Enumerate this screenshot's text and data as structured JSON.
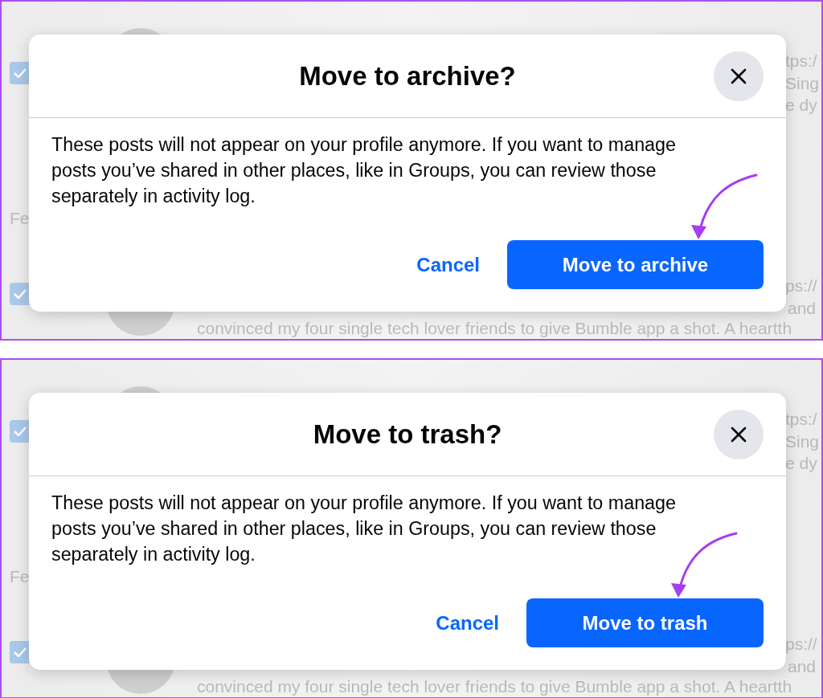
{
  "panels": [
    {
      "background": {
        "section_label": "Fe",
        "link_1": "tps:/",
        "snippet_1": "Sing",
        "snippet_2": "e dy",
        "link_2": "ps://",
        "snippet_3": "and",
        "excerpt": "convinced my four single tech lover friends to give Bumble app a shot. A heartth",
        "checkboxes": [
          {
            "checked": true
          },
          {
            "checked": true
          }
        ]
      },
      "dialog": {
        "title": "Move to archive?",
        "body": "These posts will not appear on your profile anymore. If you want to manage posts you’ve shared in other places, like in Groups, you can review those separately in activity log.",
        "cancel": "Cancel",
        "confirm": "Move to archive"
      },
      "annotation": {
        "kind": "arrow"
      }
    },
    {
      "background": {
        "section_label": "Fe",
        "link_1": "tps:/",
        "snippet_1": "Sing",
        "snippet_2": "e dy",
        "link_2": "ps://",
        "snippet_3": "and",
        "excerpt": "convinced my four single tech lover friends to give Bumble app a shot. A heartth",
        "checkboxes": [
          {
            "checked": true
          },
          {
            "checked": true
          }
        ]
      },
      "dialog": {
        "title": "Move to trash?",
        "body": "These posts will not appear on your profile anymore. If you want to manage posts you’ve shared in other places, like in Groups, you can review those separately in activity log.",
        "cancel": "Cancel",
        "confirm": "Move to trash"
      },
      "annotation": {
        "kind": "arrow"
      }
    }
  ]
}
